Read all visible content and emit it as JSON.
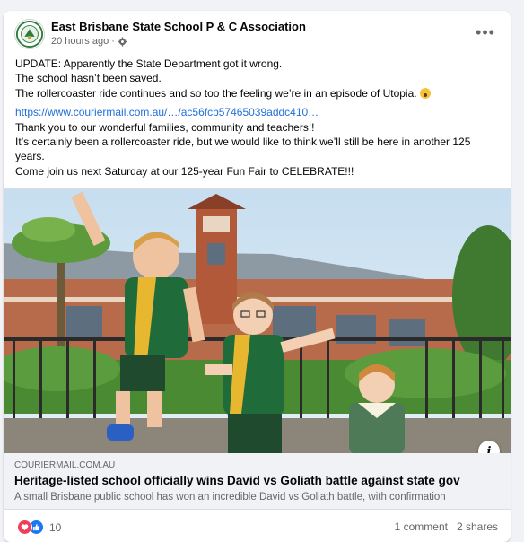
{
  "post": {
    "page_name": "East Brisbane State School P & C Association",
    "timestamp": "20 hours ago",
    "privacy_icon": "gear-icon",
    "more_icon": "more-options-icon",
    "more_label": "•••",
    "paragraph1": [
      "UPDATE: Apparently the State Department got it wrong.",
      "The school hasn’t been saved.",
      "The rollercoaster ride continues and so too the feeling we’re in an episode of Utopia."
    ],
    "emoji": "astonished-face-emoji",
    "link_url": "https://www.couriermail.com.au/…/ac56fcb57465039addc410…",
    "paragraph2": [
      "Thank you to our wonderful families, community and teachers!!",
      "It’s certainly been a rollercoaster ride, but we would like to think we’ll still be here in another 125 years.",
      "Come join us next Saturday at our 125-year Fun Fair to CELEBRATE!!!"
    ]
  },
  "link_preview": {
    "image": "photo of three children in green and gold school uniforms in front of a heritage brick school building",
    "info_icon": "info-icon",
    "info_label": "i",
    "domain": "COURIERMAIL.COM.AU",
    "headline": "Heritage-listed school officially wins David vs Goliath battle against state gov",
    "description": "A small Brisbane public school has won an incredible David vs Goliath battle, with confirmation"
  },
  "footer": {
    "reaction_icons": [
      "love-reaction-icon",
      "like-reaction-icon"
    ],
    "reaction_count": "10",
    "comments": "1 comment",
    "shares": "2 shares"
  },
  "colors": {
    "link": "#216fdb",
    "secondary_text": "#65676b",
    "like_blue": "#1877f2",
    "love_red": "#f33e58"
  }
}
